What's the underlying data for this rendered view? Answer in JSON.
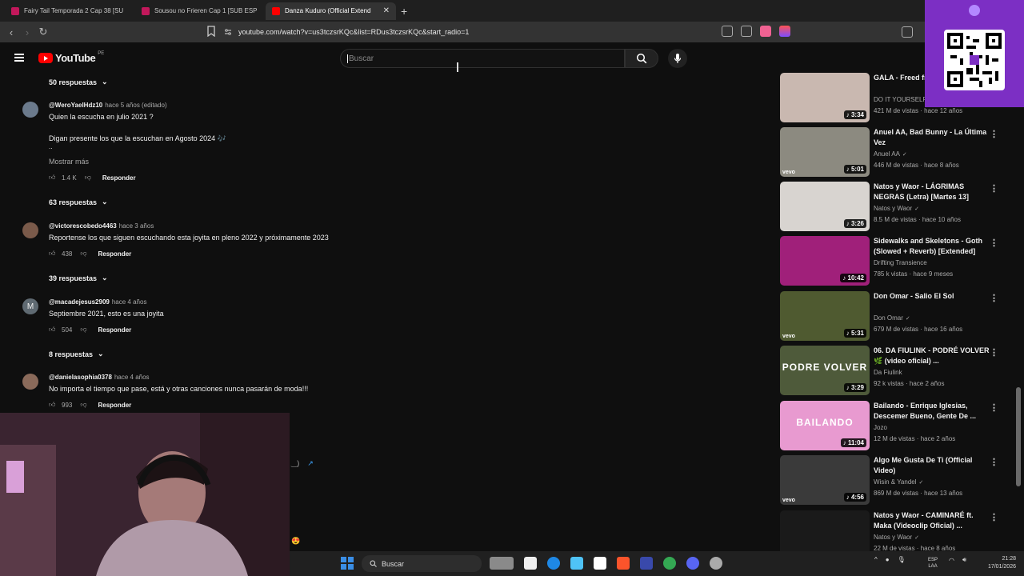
{
  "browser": {
    "tabs": [
      {
        "title": "Fairy Tail Temporada 2 Cap 38 [SU",
        "active": false,
        "favicon_color": "#c2185b"
      },
      {
        "title": "Sousou no Frieren Cap 1 [SUB ESP",
        "active": false,
        "favicon_color": "#c2185b"
      },
      {
        "title": "Danza Kuduro (Official Extend",
        "active": true,
        "favicon_color": "#ff0000"
      }
    ],
    "new_tab": "+",
    "url": "youtube.com/watch?v=us3tczsrKQc&list=RDus3tczsrKQc&start_radio=1"
  },
  "header": {
    "logo_text": "YouTube",
    "region": "PE",
    "search_placeholder": "Buscar"
  },
  "comments": [
    {
      "replies_label": "50 respuestas"
    },
    {
      "author": "@WeroYaelHdz10",
      "time": "hace 5 años (editado)",
      "lines": [
        "Quien la escucha en julio 2021 ?",
        "Digan presente los que la escuchan en Agosto 2024 🎶",
        ".."
      ],
      "more": "Mostrar más",
      "likes": "1.4 K",
      "reply": "Responder",
      "replies_label": "63 respuestas",
      "avatar_color": "#6b7a8c"
    },
    {
      "author": "@victorescobedo4463",
      "time": "hace 3 años",
      "lines": [
        "Reportense los que siguen escuchando esta joyita en pleno 2022 y próximamente 2023"
      ],
      "likes": "438",
      "reply": "Responder",
      "replies_label": "39 respuestas",
      "avatar_color": "#7a5a4a"
    },
    {
      "author": "@macadejesus2909",
      "time": "hace 4 años",
      "lines": [
        "Septiembre 2021, esto es una joyita"
      ],
      "likes": "504",
      "reply": "Responder",
      "replies_label": "8 respuestas",
      "avatar_letter": "M",
      "avatar_color": "#5f6a72"
    },
    {
      "author": "@danielasophia0378",
      "time": "hace 4 años",
      "lines": [
        "No importa el tiempo que pase, está y otras canciones nunca pasarán de moda!!!"
      ],
      "likes": "993",
      "reply": "Responder",
      "avatar_color": "#8a6a5a"
    }
  ],
  "sidebar": [
    {
      "title": "GALA - Freed fr [Official Video]",
      "channel": "DO IT YOURSELF",
      "meta": "421 M de vistas · hace 12 años",
      "duration": "3:34",
      "thumb": "#c9b8b0",
      "vevo": false
    },
    {
      "title": "Anuel AA, Bad Bunny - La Última Vez",
      "channel": "Anuel AA",
      "verified": true,
      "meta": "446 M de vistas · hace 8 años",
      "duration": "5:01",
      "thumb": "#8c8a80",
      "vevo": true
    },
    {
      "title": "Natos y Waor - LÁGRIMAS NEGRAS (Letra) [Martes 13]",
      "channel": "Natos y Waor",
      "verified": true,
      "meta": "8.5 M de vistas · hace 10 años",
      "duration": "3:26",
      "thumb": "#d8d4d0",
      "vevo": false
    },
    {
      "title": "Sidewalks and Skeletons - Goth (Slowed + Reverb) [Extended]",
      "channel": "Drifting Transience",
      "meta": "785 k vistas · hace 9 meses",
      "duration": "10:42",
      "thumb": "#a0207a",
      "vevo": false
    },
    {
      "title": "Don Omar - Salio El Sol",
      "channel": "Don Omar",
      "verified": true,
      "meta": "679 M de vistas · hace 16 años",
      "duration": "5:31",
      "thumb": "#4f5a30",
      "vevo": true
    },
    {
      "title": "06. DA FIULINK - PODRÉ VOLVER 🌿 (video oficial) ...",
      "channel": "Da Fiulink",
      "meta": "92 k vistas · hace 2 años",
      "duration": "3:29",
      "thumb": "#4e5a3a",
      "vevo": false,
      "overlay_text": "PODRE VOLVER"
    },
    {
      "title": "Bailando - Enrique Iglesias, Descemer Bueno, Gente De ...",
      "channel": "Jozo",
      "meta": "12 M de vistas · hace 2 años",
      "duration": "11:04",
      "thumb": "#e89ad0",
      "vevo": false,
      "overlay_text": "BAILANDO"
    },
    {
      "title": "Algo Me Gusta De Ti (Official Video)",
      "channel": "Wisin & Yandel",
      "verified": true,
      "meta": "869 M de vistas · hace 13 años",
      "duration": "4:56",
      "thumb": "#3a3a3a",
      "vevo": true
    },
    {
      "title": "Natos y Waor - CAMINARÉ ft. Maka (Videoclip Oficial) ...",
      "channel": "Natos y Waor",
      "verified": true,
      "meta": "22 M de vistas · hace 8 años",
      "duration": "",
      "thumb": "#1a1a1a",
      "vevo": false
    }
  ],
  "taskbar": {
    "search_label": "Buscar",
    "lang_top": "ESP",
    "lang_bottom": "LAA",
    "time": "21:28",
    "date": "17/01/2026"
  },
  "colors": {
    "brand": "#ff0000",
    "qr_panel": "#7c2fc4",
    "link": "#3ea6ff"
  }
}
